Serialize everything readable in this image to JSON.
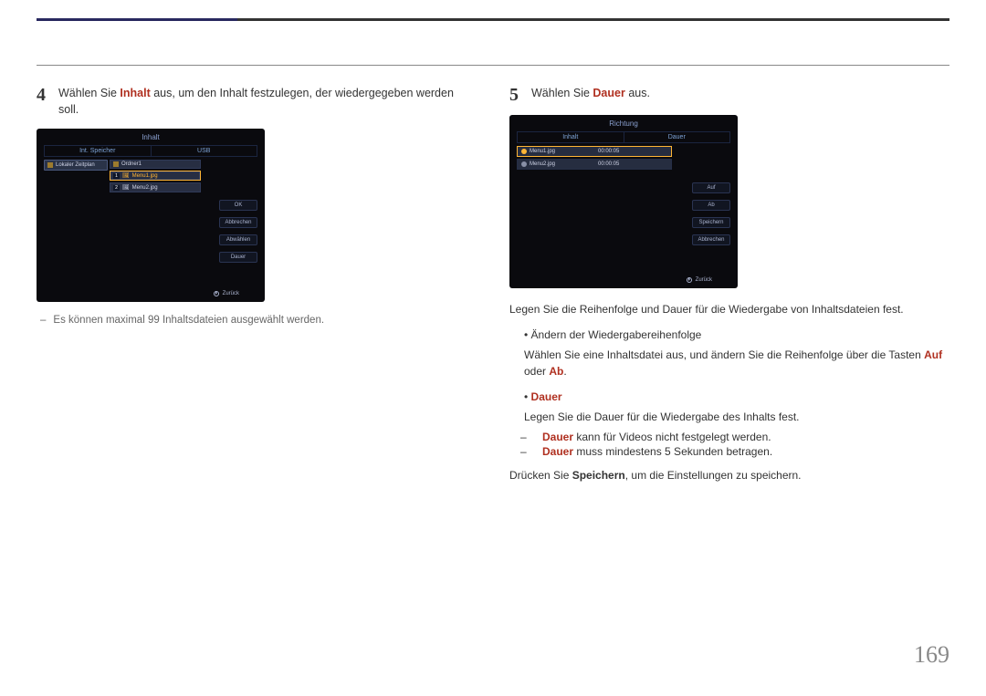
{
  "left": {
    "step_num": "4",
    "step_text_before": "Wählen Sie ",
    "step_kw": "Inhalt",
    "step_text_after": " aus, um den Inhalt festzulegen, der wiedergegeben werden soll.",
    "screen": {
      "title": "Inhalt",
      "tab1": "Int. Speicher",
      "tab2": "USB",
      "left_item": "Lokaler Zeitplan",
      "mid_folder": "Ordner1",
      "mid_file1_idx": "1",
      "mid_file1": "Menu1.jpg",
      "mid_file2_idx": "2",
      "mid_file2": "Menu2.jpg",
      "btn_ok": "OK",
      "btn_cancel": "Abbrechen",
      "btn_deselect": "Abwählen",
      "btn_dauer": "Dauer",
      "return": "Zurück"
    },
    "dash_note": "Es können maximal 99 Inhaltsdateien ausgewählt werden."
  },
  "right": {
    "step_num": "5",
    "step_text_before": "Wählen Sie ",
    "step_kw": "Dauer",
    "step_text_after": " aus.",
    "screen": {
      "title": "Richtung",
      "tab1": "Inhalt",
      "tab2": "Dauer",
      "row1_name": "Menu1.jpg",
      "row1_dur": "00:00:05",
      "row2_name": "Menu2.jpg",
      "row2_dur": "00:00:05",
      "btn_up": "Auf",
      "btn_down": "Ab",
      "btn_save": "Speichern",
      "btn_cancel": "Abbrechen",
      "return": "Zurück"
    },
    "p1": "Legen Sie die Reihenfolge und Dauer für die Wiedergabe von Inhaltsdateien fest.",
    "b1": "Ändern der Wiedergabereihenfolge",
    "b1_desc_a": "Wählen Sie eine Inhaltsdatei aus, und ändern Sie die Reihenfolge über die Tasten ",
    "b1_kw1": "Auf",
    "b1_mid": " oder ",
    "b1_kw2": "Ab",
    "b1_end": ".",
    "b2": "Dauer",
    "b2_desc": "Legen Sie die Dauer für die Wiedergabe des Inhalts fest.",
    "sub1_kw": "Dauer",
    "sub1_rest": " kann für Videos nicht festgelegt werden.",
    "sub2_kw": "Dauer",
    "sub2_rest": " muss mindestens 5 Sekunden betragen.",
    "p2_a": "Drücken Sie ",
    "p2_kw": "Speichern",
    "p2_b": ", um die Einstellungen zu speichern."
  },
  "page_number": "169"
}
